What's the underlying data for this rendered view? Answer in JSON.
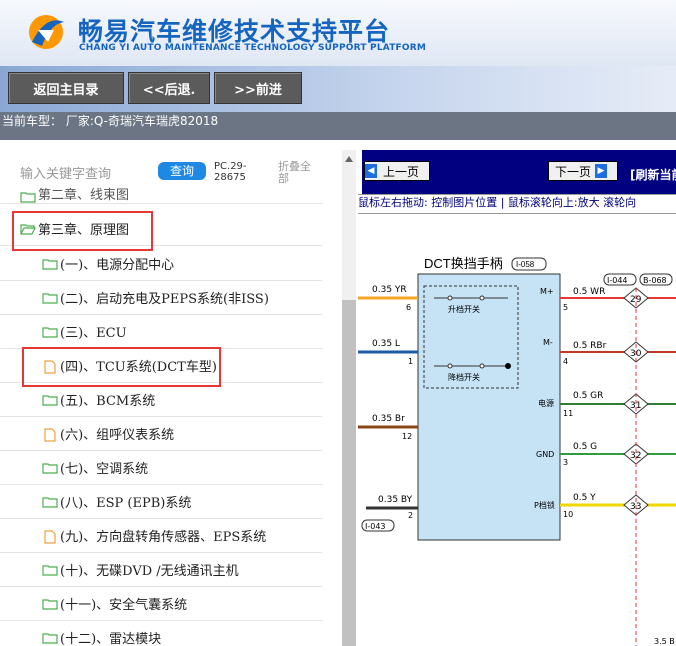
{
  "header": {
    "title": "畅易汽车维修技术支持平台",
    "subtitle": "CHANG YI AUTO MAINTENANCE TECHNOLOGY SUPPORT PLATFORM"
  },
  "nav": {
    "home": "返回主目录",
    "back": "<<后退.",
    "forward": ">>前进"
  },
  "current_model": "当前车型：  厂家:Q-奇瑞汽车瑞虎82018",
  "search": {
    "placeholder": "输入关键字查询",
    "query": "查询",
    "pc_label": "PC.29-28675",
    "collapse": "折叠全部"
  },
  "tree": {
    "partial_top": "第二章、线束图",
    "items": [
      {
        "label": "第三章、原理图",
        "icon": "folder-open-icon"
      },
      {
        "label": "(一)、电源分配中心",
        "icon": "folder-icon"
      },
      {
        "label": "(二)、启动充电及PEPS系统(非ISS)",
        "icon": "folder-icon"
      },
      {
        "label": "(三)、ECU",
        "icon": "folder-icon"
      },
      {
        "label": "(四)、TCU系统(DCT车型)",
        "icon": "document-icon"
      },
      {
        "label": "(五)、BCM系统",
        "icon": "folder-icon"
      },
      {
        "label": "(六)、组呼仪表系统",
        "icon": "document-icon"
      },
      {
        "label": "(七)、空调系统",
        "icon": "folder-icon"
      },
      {
        "label": "(八)、ESP (EPB)系统",
        "icon": "folder-icon"
      },
      {
        "label": "(九)、方向盘转角传感器、EPS系统",
        "icon": "document-icon"
      },
      {
        "label": "(十)、无碟DVD /无线通讯主机",
        "icon": "folder-icon"
      },
      {
        "label": "(十一)、安全气囊系统",
        "icon": "folder-icon"
      },
      {
        "label": "(十二)、雷达模块",
        "icon": "folder-icon"
      }
    ]
  },
  "viewer": {
    "prev": "上一页",
    "next": "下一页",
    "refresh": "[刷新当前",
    "tip": "鼠标左右拖动: 控制图片位置 | 鼠标滚轮向上:放大  滚轮向"
  },
  "diagram": {
    "component": "DCT换挡手柄",
    "component_code": "I-058",
    "up_switch": "升档开关",
    "down_switch": "降档开关",
    "connector_a": "I-044",
    "connector_b": "B-068",
    "connector_c": "I-043",
    "left_wires": [
      {
        "label": "0.35 YR",
        "pin": "6",
        "color": "#f5a623"
      },
      {
        "label": "0.35 L",
        "pin": "1",
        "color": "#1e5aa8"
      },
      {
        "label": "0.35 Br",
        "pin": "12",
        "color": "#8b4513"
      },
      {
        "label": "0.35 BY",
        "pin": "2",
        "color": "#333333"
      }
    ],
    "right_wires": [
      {
        "label": "0.5 WR",
        "pin": "5",
        "signal": "M+",
        "node": "29",
        "color": "#e53935"
      },
      {
        "label": "0.5 RBr",
        "pin": "4",
        "signal": "M-",
        "node": "30",
        "color": "#c0392b"
      },
      {
        "label": "0.5 GR",
        "pin": "11",
        "signal": "电源",
        "node": "31",
        "color": "#2e7d32"
      },
      {
        "label": "0.5 G",
        "pin": "3",
        "signal": "GND",
        "node": "32",
        "color": "#2e9d3e"
      },
      {
        "label": "0.5 Y",
        "pin": "10",
        "signal": "P档锁",
        "node": "33",
        "color": "#f2d600"
      }
    ],
    "bottom_partial": "3.5 B"
  },
  "colors": {
    "brand": "#1565c0",
    "viewer_toolbar": "#000080",
    "highlight": "#e53935",
    "component_fill": "#c6e3f5"
  }
}
